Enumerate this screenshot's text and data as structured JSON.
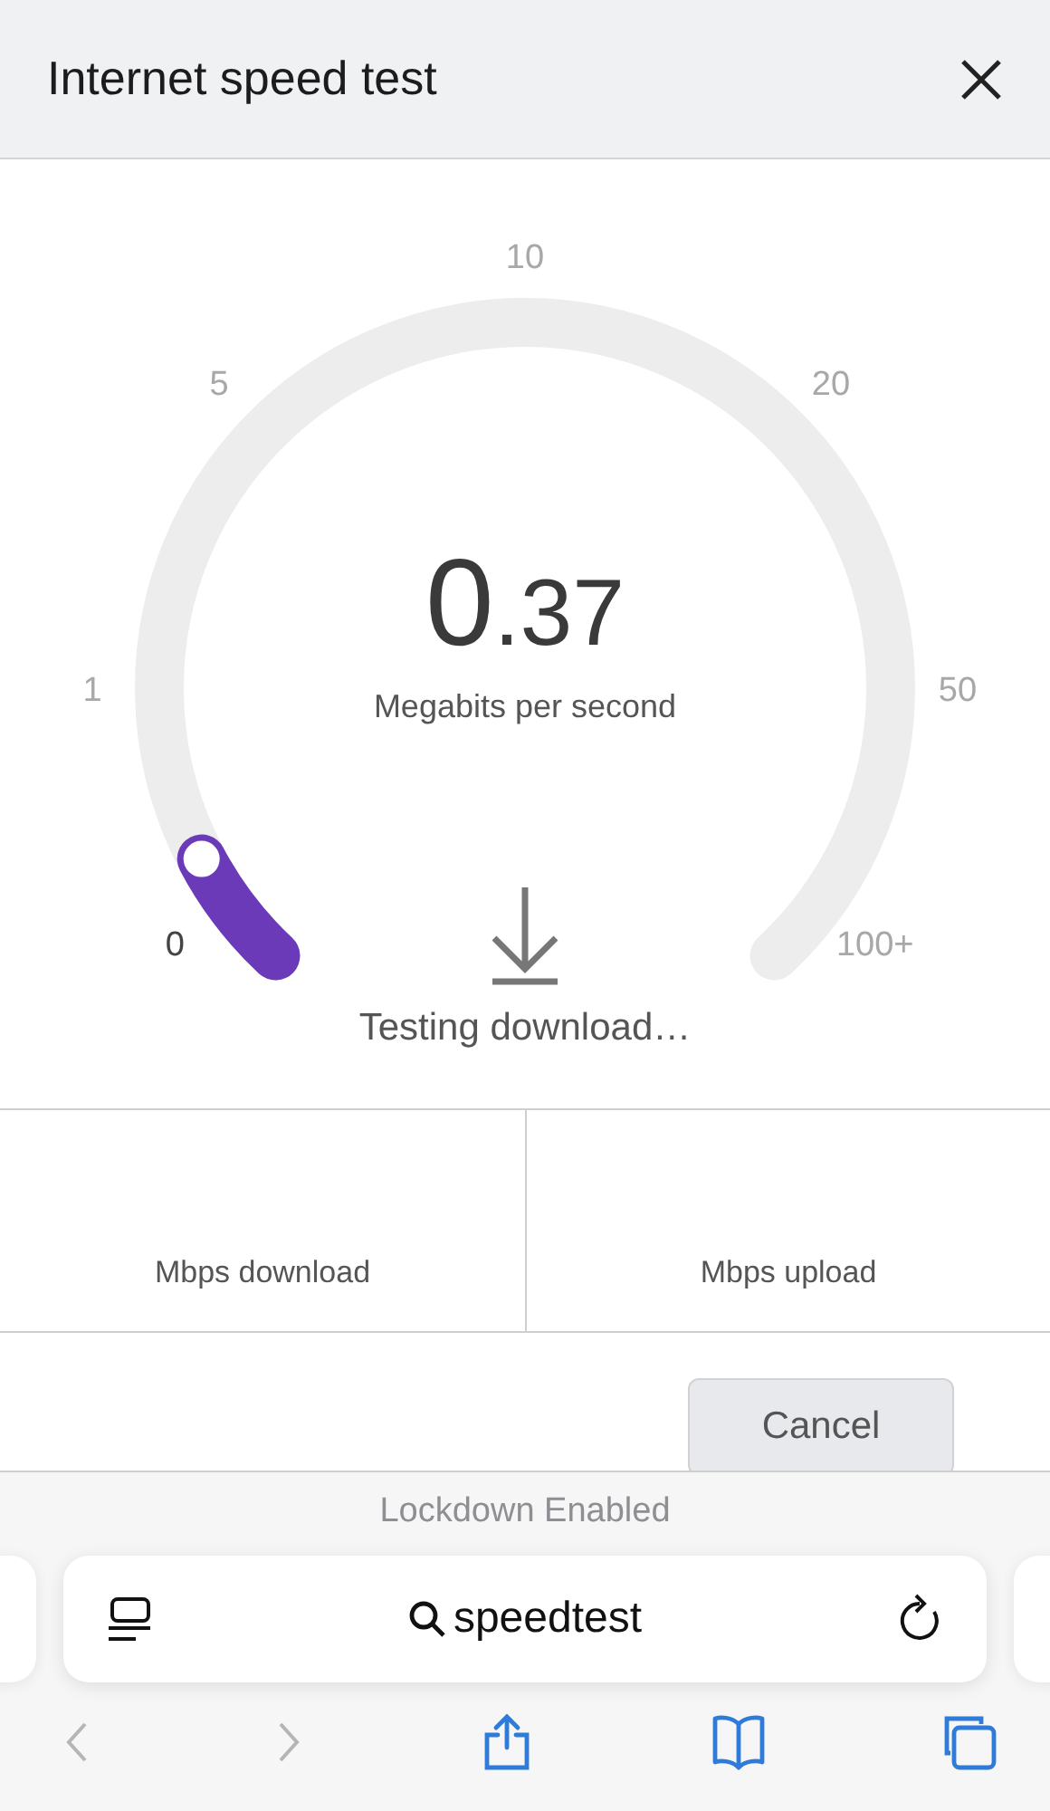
{
  "header": {
    "title": "Internet speed test"
  },
  "gauge": {
    "ticks": [
      {
        "label": "0",
        "active": true
      },
      {
        "label": "1",
        "active": false
      },
      {
        "label": "5",
        "active": false
      },
      {
        "label": "10",
        "active": false
      },
      {
        "label": "20",
        "active": false
      },
      {
        "label": "50",
        "active": false
      },
      {
        "label": "100+",
        "active": false
      }
    ],
    "value": "0.37",
    "unit": "Megabits per second",
    "status": "Testing download…"
  },
  "stats": [
    {
      "label": "Mbps download"
    },
    {
      "label": "Mbps upload"
    }
  ],
  "buttons": [
    "Cancel"
  ],
  "browser": {
    "notice": "Lockdown Enabled",
    "address": "speedtest",
    "toolbar": [
      {
        "kind": "back",
        "disabled": true
      },
      {
        "kind": "forward",
        "disabled": true
      },
      {
        "kind": "share",
        "disabled": false
      },
      {
        "kind": "bookmarks",
        "disabled": false
      },
      {
        "kind": "tabs",
        "disabled": false
      }
    ]
  }
}
